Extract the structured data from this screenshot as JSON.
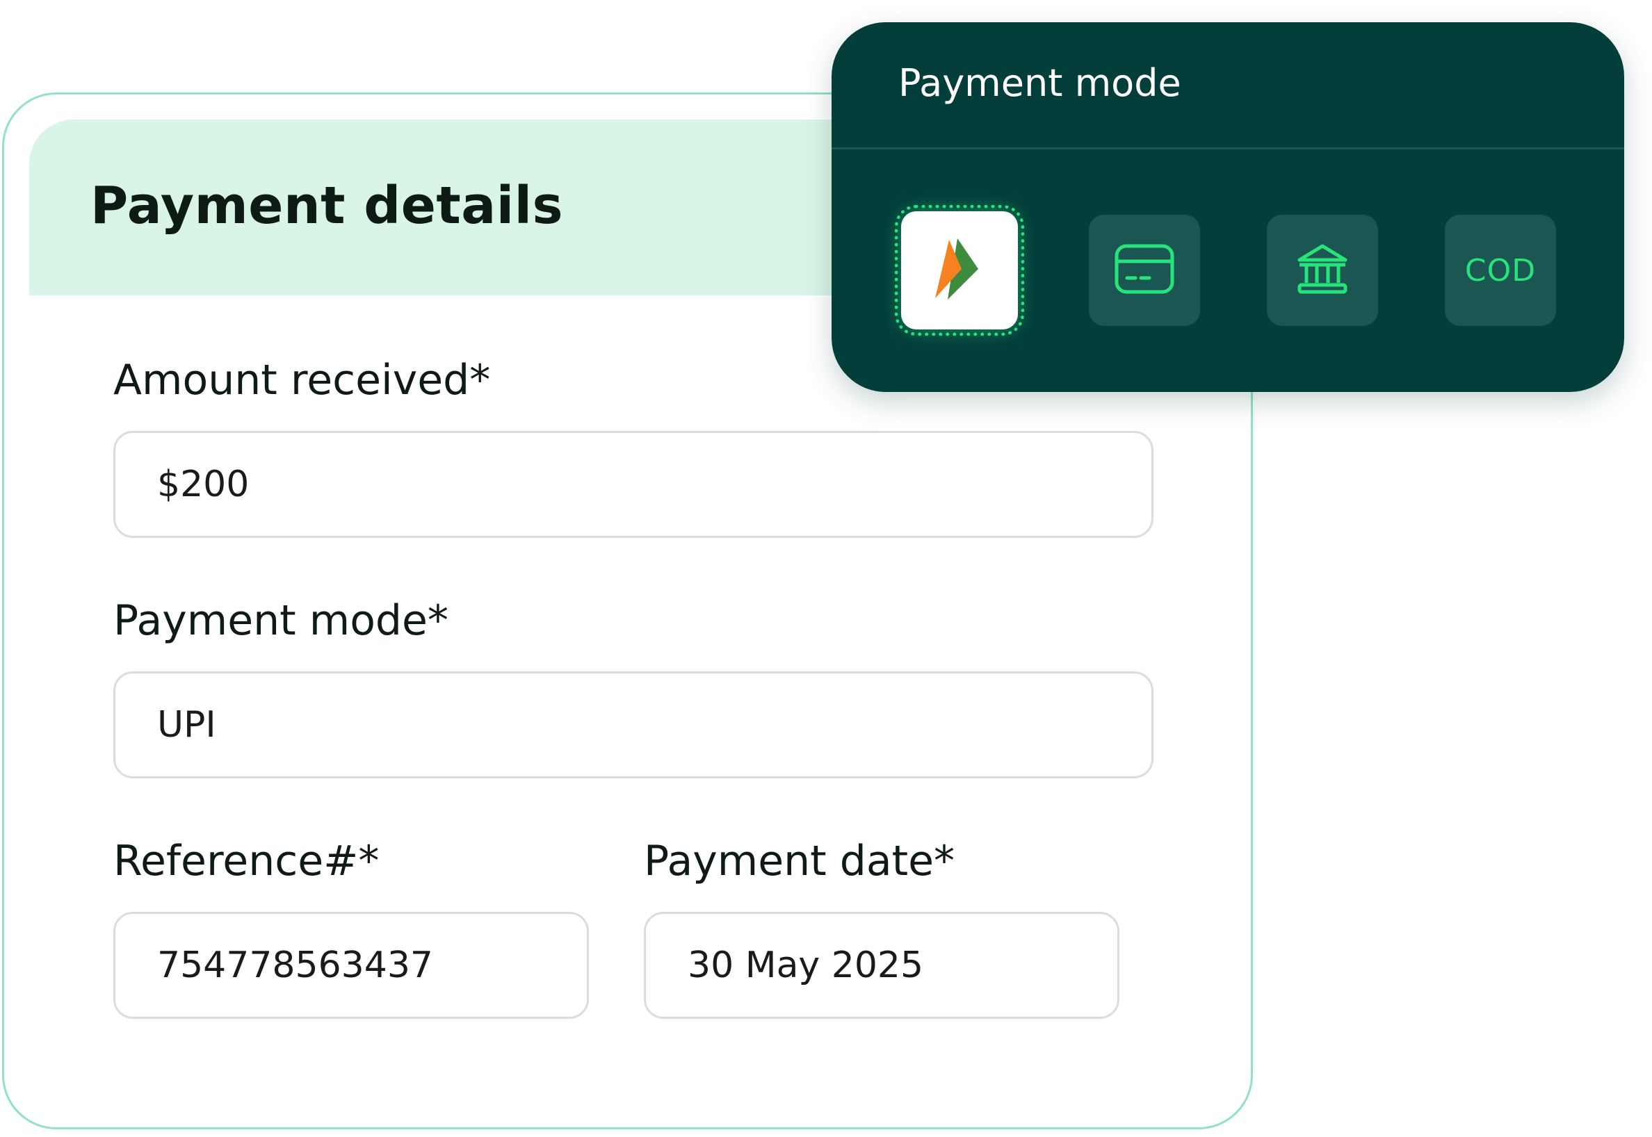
{
  "details": {
    "title": "Payment details",
    "amount": {
      "label": "Amount received*",
      "value": "$200"
    },
    "mode": {
      "label": "Payment mode*",
      "value": "UPI"
    },
    "reference": {
      "label": "Reference#*",
      "value": "754778563437"
    },
    "date": {
      "label": "Payment date*",
      "value": "30 May 2025"
    }
  },
  "popup": {
    "title": "Payment mode",
    "options": [
      {
        "icon": "upi-logo-icon",
        "selected": true
      },
      {
        "icon": "credit-card-icon",
        "selected": false
      },
      {
        "icon": "bank-icon",
        "selected": false
      },
      {
        "label": "COD",
        "selected": false
      }
    ]
  },
  "colors": {
    "card_border": "#8fe3c2",
    "header_bg": "#d9f5e7",
    "popup_bg": "#033e3b",
    "tile_bg": "#1a5752",
    "accent_green": "#27e37a",
    "upi_orange": "#f58220",
    "upi_green": "#3d8b3d"
  }
}
